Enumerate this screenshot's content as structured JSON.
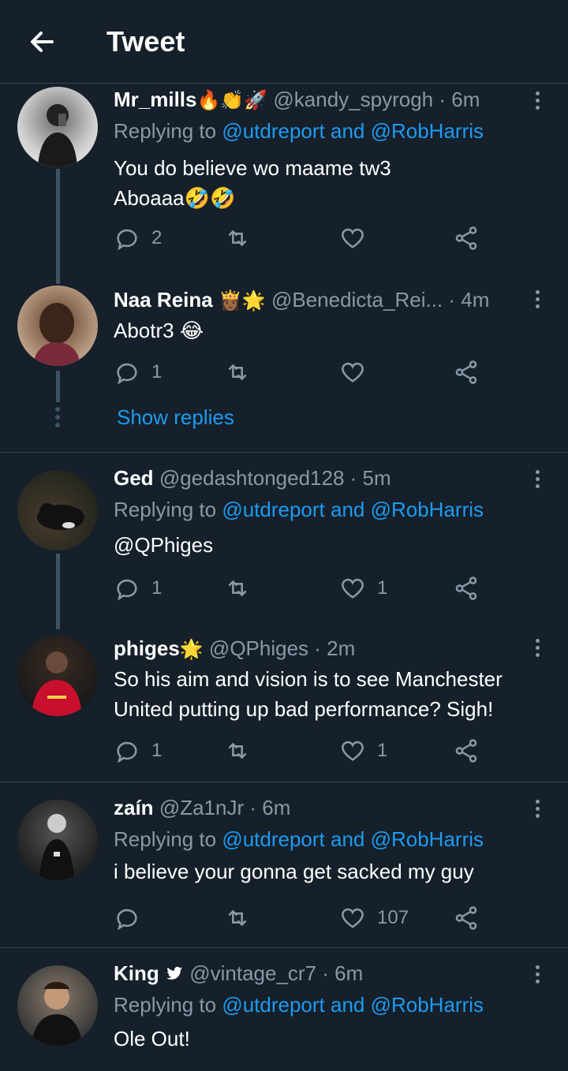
{
  "header": {
    "title": "Tweet"
  },
  "tweets": [
    {
      "name": "Mr_mills",
      "name_emojis": "🔥👏🚀",
      "handle": "@kandy_spyrogh",
      "time": "· 6m",
      "replying_prefix": "Replying to",
      "replying_to": "@utdreport and @RobHarris",
      "text_lines": [
        "You do believe wo maame tw3",
        "Aboaaa🤣🤣"
      ],
      "replies": "2",
      "retweets": "",
      "likes": ""
    },
    {
      "name": "Naa Reina",
      "name_emojis": "👸🏾🌟",
      "handle": "@Benedicta_Rei...",
      "time": "· 4m",
      "text_lines": [
        "Abotr3 😂"
      ],
      "replies": "1",
      "retweets": "",
      "likes": ""
    },
    {
      "show_replies": "Show replies"
    },
    {
      "name": "Ged",
      "handle": "@gedashtonged128",
      "time": "· 5m",
      "replying_prefix": "Replying to",
      "replying_to": "@utdreport and @RobHarris",
      "text_lines": [
        "@QPhiges"
      ],
      "replies": "1",
      "retweets": "",
      "likes": "1"
    },
    {
      "name": "phiges",
      "name_emojis": "🌟",
      "handle": "@QPhiges",
      "time": "· 2m",
      "text_lines": [
        "So his aim and vision is to see Manchester",
        "United putting up bad performance? Sigh!"
      ],
      "replies": "1",
      "retweets": "",
      "likes": "1"
    },
    {
      "name": "zaín",
      "handle": "@Za1nJr",
      "time": "· 6m",
      "replying_prefix": "Replying to",
      "replying_to": "@utdreport and @RobHarris",
      "text_lines": [
        "i believe your gonna get sacked my guy"
      ],
      "replies": "",
      "retweets": "",
      "likes": "107"
    },
    {
      "name": "King",
      "handle": "@vintage_cr7",
      "time": "· 6m",
      "replying_prefix": "Replying to",
      "replying_to": "@utdreport and @RobHarris",
      "text_lines": [
        "Ole Out!"
      ]
    }
  ]
}
